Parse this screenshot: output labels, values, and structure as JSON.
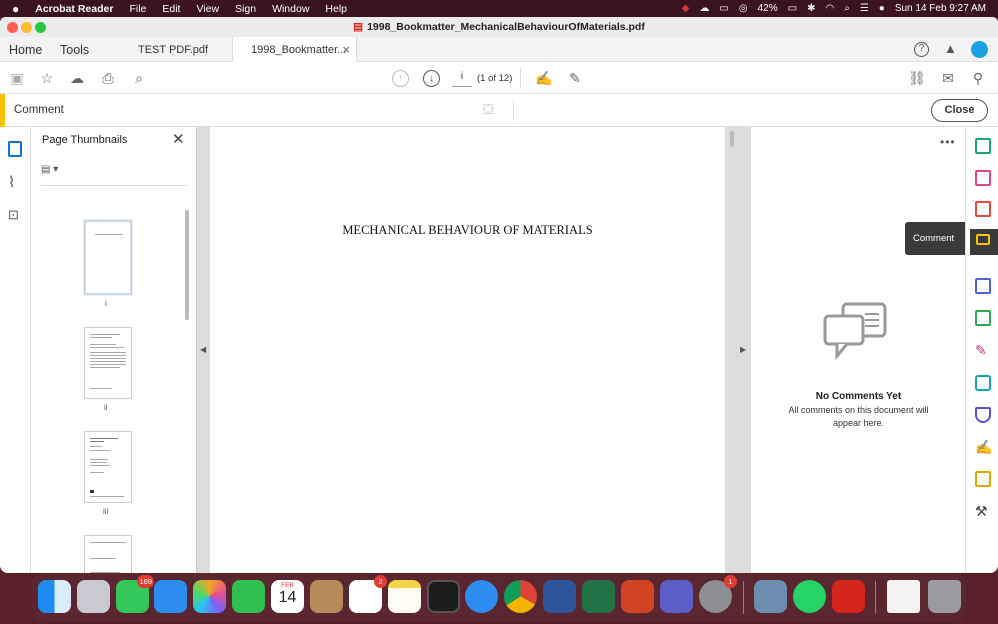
{
  "menubar": {
    "app_name": "Acrobat Reader",
    "menus": [
      "File",
      "Edit",
      "View",
      "Sign",
      "Window",
      "Help"
    ],
    "battery": "42%",
    "datetime": "Sun 14 Feb  9:27 AM"
  },
  "window": {
    "title": "1998_Bookmatter_MechanicalBehaviourOfMaterials.pdf"
  },
  "tabs": {
    "home": "Home",
    "tools": "Tools",
    "doc1": "TEST PDF.pdf",
    "doc2": "1998_Bookmatter...",
    "close_glyph": "×"
  },
  "toolbar": {
    "page_input": "i",
    "page_count": "(1 of 12)"
  },
  "comment_bar": {
    "label": "Comment",
    "close_button": "Close"
  },
  "thumbnails": {
    "title": "Page Thumbnails",
    "labels": [
      "i",
      "ii",
      "iii"
    ]
  },
  "document": {
    "heading": "MECHANICAL BEHAVIOUR OF MATERIALS"
  },
  "comments_panel": {
    "empty_title": "No Comments Yet",
    "empty_line1": "All comments on this document will",
    "empty_line2": "appear here."
  },
  "tooltip": {
    "label": "Comment"
  },
  "dock": {
    "messages_badge": "169",
    "reminders_badge": "2",
    "sysprefs_badge": "1",
    "calendar_month": "FEB",
    "calendar_day": "14"
  },
  "colors": {
    "accent": "#0b72d6",
    "comment_highlight": "#f5c400",
    "acrobat_red": "#d6251a"
  }
}
